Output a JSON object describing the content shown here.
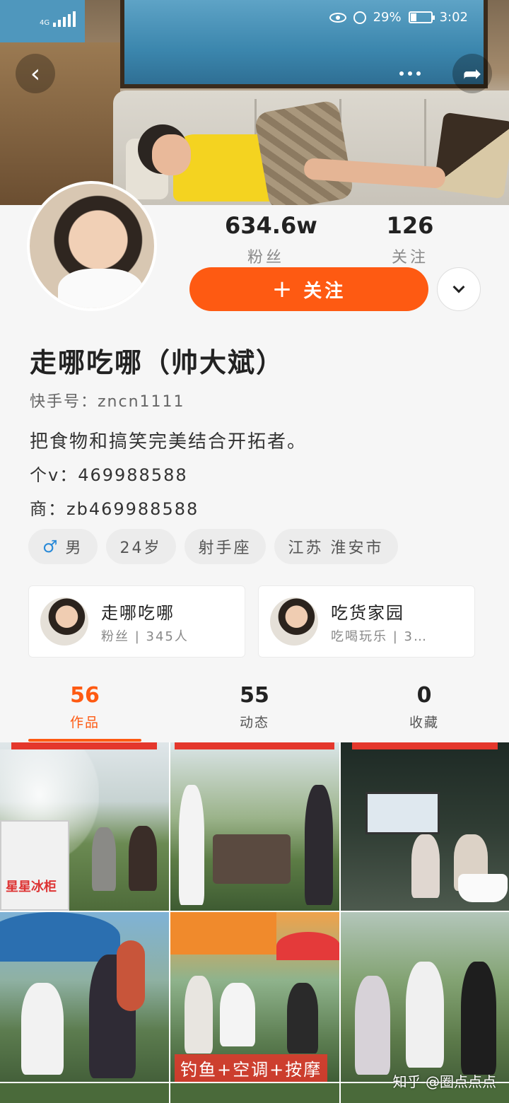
{
  "status_bar": {
    "network": "4G",
    "battery": "29%",
    "battery_level": 0.29,
    "time": "3:02"
  },
  "header": {
    "back_icon": "chevron-left-icon",
    "more_icon": "more-dots-icon",
    "share_icon": "share-arrow-icon"
  },
  "profile": {
    "followers_count": "634.6w",
    "followers_label": "粉丝",
    "following_count": "126",
    "following_label": "关注",
    "follow_button": "关注",
    "name": "走哪吃哪（帅大斌）",
    "kuaishou_id": "快手号：zncn1111",
    "bio_line1": "把食物和搞笑完美结合开拓者。",
    "bio_line2": "个v：469988588",
    "bio_line3": "商：zb469988588",
    "tags": {
      "gender": "男",
      "age": "24岁",
      "zodiac": "射手座",
      "location": "江苏 淮安市"
    }
  },
  "groups": [
    {
      "name": "走哪吃哪",
      "sub": "粉丝 | 345人"
    },
    {
      "name": "吃货家园",
      "sub": "吃喝玩乐 | 3…"
    }
  ],
  "tabs": [
    {
      "count": "56",
      "label": "作品"
    },
    {
      "count": "55",
      "label": "动态"
    },
    {
      "count": "0",
      "label": "收藏"
    }
  ],
  "grid": {
    "freezer_text": "星星冰柜",
    "cell5_caption": "钓鱼+空调+按摩"
  },
  "watermark": "知乎 @圈点点点",
  "colors": {
    "accent": "#fe5a12",
    "male_icon": "#2a8ad8",
    "banner_red": "#e4372c"
  }
}
